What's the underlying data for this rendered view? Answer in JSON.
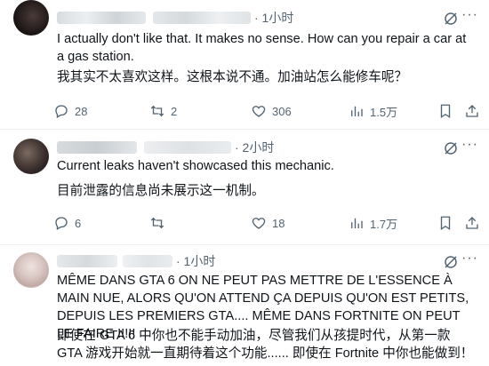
{
  "tweets": [
    {
      "time": "· 1小时",
      "text": "I actually don't like that. It makes no sense. How can you repair a car at a gas station.",
      "translation": "我其实不太喜欢这样。这根本说不通。加油站怎么能修车呢？",
      "replies": "28",
      "retweets": "2",
      "likes": "306",
      "views": "1.5万"
    },
    {
      "time": "· 2小时",
      "text": "Current leaks haven't showcased this mechanic.",
      "translation": "目前泄露的信息尚未展示这一机制。",
      "replies": "6",
      "retweets": "",
      "likes": "18",
      "views": "1.7万"
    },
    {
      "time": "· 1小时",
      "text": "MÊME DANS GTA 6 ON NE PEUT PAS METTRE DE L'ESSENCE À MAIN NUE, ALORS QU'ON ATTEND ÇA DEPUIS QU'ON EST PETITS, DEPUIS LES PREMIERS GTA.... MÊME DANS FORTNITE ON PEUT LE FAIRE !!!!!",
      "translation": "即使在 GTA 6 中你也不能手动加油，尽管我们从孩提时代，从第一款 GTA 游戏开始就一直期待着这个功能...... 即使在 Fortnite 中你也能做到！"
    }
  ],
  "icons": {
    "more": "more-icon",
    "grok": "grok-icon",
    "reply": "reply-icon",
    "retweet": "retweet-icon",
    "like": "heart-icon",
    "views": "views-icon",
    "bookmark": "bookmark-icon",
    "share": "share-icon"
  },
  "colors": {
    "text": "#0f1419",
    "secondary": "#536471",
    "divider": "#eff3f4"
  }
}
